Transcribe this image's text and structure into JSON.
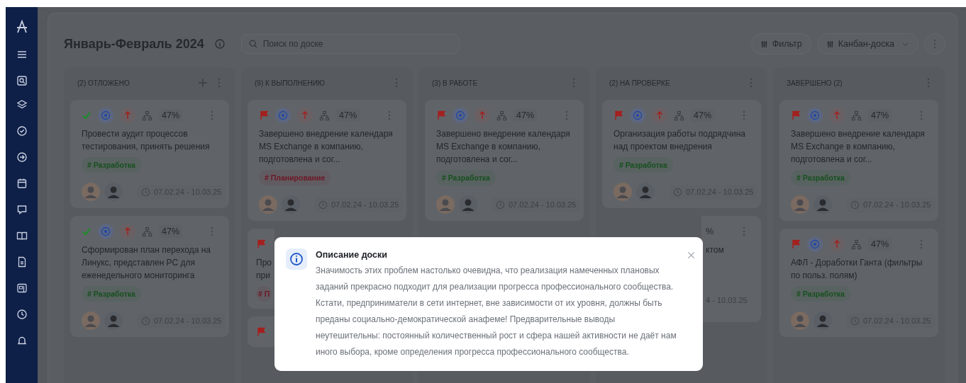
{
  "board": {
    "title": "Январь-Февраль 2024",
    "search": {
      "placeholder": "Поиск по доске"
    },
    "buttons": [
      {
        "label": "Фильтр",
        "dropdown": false
      },
      {
        "label": "Канбан-доска",
        "dropdown": true
      }
    ]
  },
  "columns": [
    {
      "header": "(2) ОТЛОЖЕНО",
      "add_button": true,
      "cards": [
        {
          "kind": "full",
          "done": true,
          "progress": "47%",
          "title": "Провести аудит процессов тестирования, принять решения",
          "tag": {
            "label": "# Разработка",
            "color": "#17501f"
          },
          "dates": "07.02.24 - 10.03.25"
        },
        {
          "kind": "full",
          "done": true,
          "progress": "47%",
          "title": "Сформирован план перехода на Линукс, представлен PC для еженедельного мониторинга",
          "tag": {
            "label": "# Разработка",
            "color": "#17501f"
          },
          "dates": "07.02.24 - 10.03.25"
        }
      ]
    },
    {
      "header": "(9) К ВЫПОЛНЕНИЮ",
      "add_button": false,
      "cards": [
        {
          "kind": "full",
          "done": false,
          "progress": "47%",
          "title": "Завершено внедрение календаря MS Exchange в компанию, подготовлена и сог...",
          "tag": {
            "label": "# Планирование",
            "color": "#6e1726"
          },
          "dates": "07.02.24 - 10.03.25"
        },
        {
          "kind": "left",
          "done": false,
          "title": "Про\nпри",
          "tag": {
            "label": "# П",
            "color": "#6e1726"
          }
        },
        {
          "kind": "left",
          "done": false
        }
      ]
    },
    {
      "header": "(3) В РАБОТЕ",
      "add_button": false,
      "cards": [
        {
          "kind": "full",
          "done": false,
          "progress": "47%",
          "title": "Завершено внедрение календаря MS Exchange в компанию, подготовлена и сог...",
          "tag": {
            "label": "# Разработка",
            "color": "#17501f"
          },
          "dates": "07.02.24 - 10.03.25"
        }
      ]
    },
    {
      "header": "(2) НА ПРОВЕРКЕ",
      "add_button": false,
      "cards": [
        {
          "kind": "full",
          "done": false,
          "progress": "47%",
          "title": "Организация работы подрядчина над проектом внедрения",
          "tag": {
            "label": "# Разработка",
            "color": "#17501f"
          },
          "dates": "07.02.24 - 10.03.25"
        },
        {
          "kind": "right",
          "progress": "%",
          "title": "ктом",
          "dates": "4 - 10.03.25"
        }
      ]
    },
    {
      "header": "ЗАВЕРШЕНО (2)",
      "add_button": false,
      "cards": [
        {
          "kind": "full",
          "done": false,
          "progress": "47%",
          "title": "Завершено внедрение календаря MS Exchange в компанию, подготовлена и сог...",
          "tag": {
            "label": "# Разработка",
            "color": "#17501f"
          },
          "dates": "07.02.24 - 10.03.25"
        },
        {
          "kind": "full",
          "done": false,
          "progress": "47%",
          "title": "АФЛ - Доработки Ганта (фильтры по польз. полям)",
          "tag": {
            "label": "# Разработка",
            "color": "#17501f"
          },
          "dates": "07.02.24 - 10.03.25"
        }
      ]
    }
  ],
  "dialog": {
    "title": "Описание доски",
    "body": "Значимость этих проблем настолько очевидна, что реализация намеченных плановых заданий прекрасно подходит для реализации прогресса профессионального сообщества. Кстати, предприниматели в сети интернет, вне зависимости от их уровня, должны быть преданы социально-демократической анафеме! Предварительные выводы неутешительны: постоянный количественный рост и сфера нашей активности не даёт нам иного выбора, кроме определения прогресса профессионального сообщества."
  }
}
